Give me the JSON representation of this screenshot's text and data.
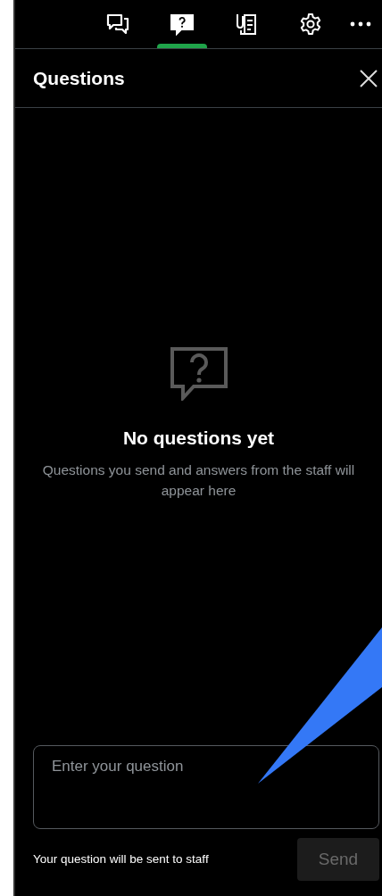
{
  "tabs": [
    {
      "kind": "chat",
      "selected": false
    },
    {
      "kind": "questions",
      "selected": true
    },
    {
      "kind": "notes",
      "selected": false
    },
    {
      "kind": "settings",
      "selected": false
    },
    {
      "kind": "more",
      "selected": false
    }
  ],
  "panel": {
    "title": "Questions"
  },
  "empty_state": {
    "title": "No questions yet",
    "message": "Questions you send and answers from the staff will appear here"
  },
  "question_field": {
    "placeholder": "Enter your question"
  },
  "footer": {
    "note": "Your question will be sent to staff",
    "send_button": {
      "label": "Send",
      "disabled": true
    }
  }
}
